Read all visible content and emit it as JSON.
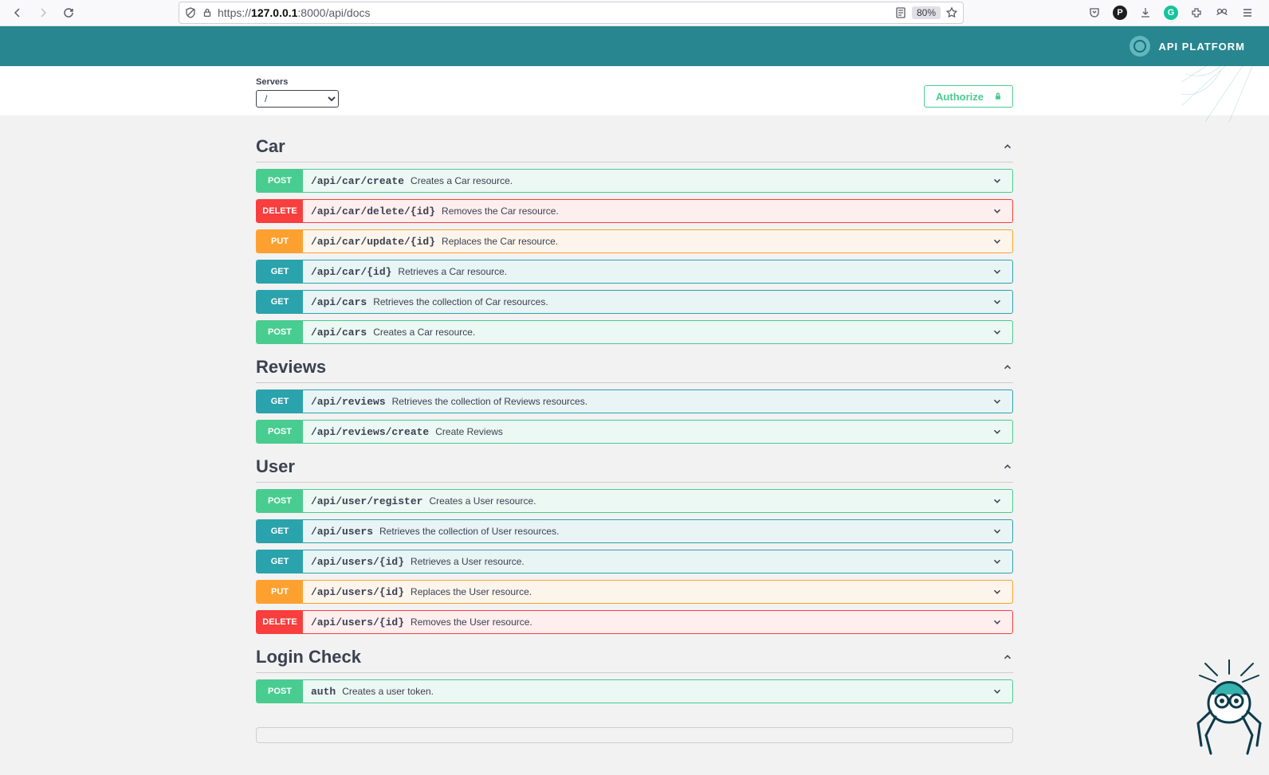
{
  "browser": {
    "url_prefix": "https://",
    "url_host": "127.0.0.1",
    "url_suffix": ":8000/api/docs",
    "zoom": "80%"
  },
  "brand": "API PLATFORM",
  "servers": {
    "label": "Servers",
    "selected": "/"
  },
  "authorize_label": "Authorize",
  "tags": [
    {
      "name": "Car",
      "ops": [
        {
          "method": "POST",
          "path": "/api/car/create",
          "desc": "Creates a Car resource."
        },
        {
          "method": "DELETE",
          "path": "/api/car/delete/{id}",
          "desc": "Removes the Car resource."
        },
        {
          "method": "PUT",
          "path": "/api/car/update/{id}",
          "desc": "Replaces the Car resource."
        },
        {
          "method": "GET",
          "path": "/api/car/{id}",
          "desc": "Retrieves a Car resource."
        },
        {
          "method": "GET",
          "path": "/api/cars",
          "desc": "Retrieves the collection of Car resources."
        },
        {
          "method": "POST",
          "path": "/api/cars",
          "desc": "Creates a Car resource."
        }
      ]
    },
    {
      "name": "Reviews",
      "ops": [
        {
          "method": "GET",
          "path": "/api/reviews",
          "desc": "Retrieves the collection of Reviews resources."
        },
        {
          "method": "POST",
          "path": "/api/reviews/create",
          "desc": "Create Reviews"
        }
      ]
    },
    {
      "name": "User",
      "ops": [
        {
          "method": "POST",
          "path": "/api/user/register",
          "desc": "Creates a User resource."
        },
        {
          "method": "GET",
          "path": "/api/users",
          "desc": "Retrieves the collection of User resources."
        },
        {
          "method": "GET",
          "path": "/api/users/{id}",
          "desc": "Retrieves a User resource."
        },
        {
          "method": "PUT",
          "path": "/api/users/{id}",
          "desc": "Replaces the User resource."
        },
        {
          "method": "DELETE",
          "path": "/api/users/{id}",
          "desc": "Removes the User resource."
        }
      ]
    },
    {
      "name": "Login Check",
      "ops": [
        {
          "method": "POST",
          "path": "auth",
          "desc": "Creates a user token."
        }
      ]
    }
  ]
}
